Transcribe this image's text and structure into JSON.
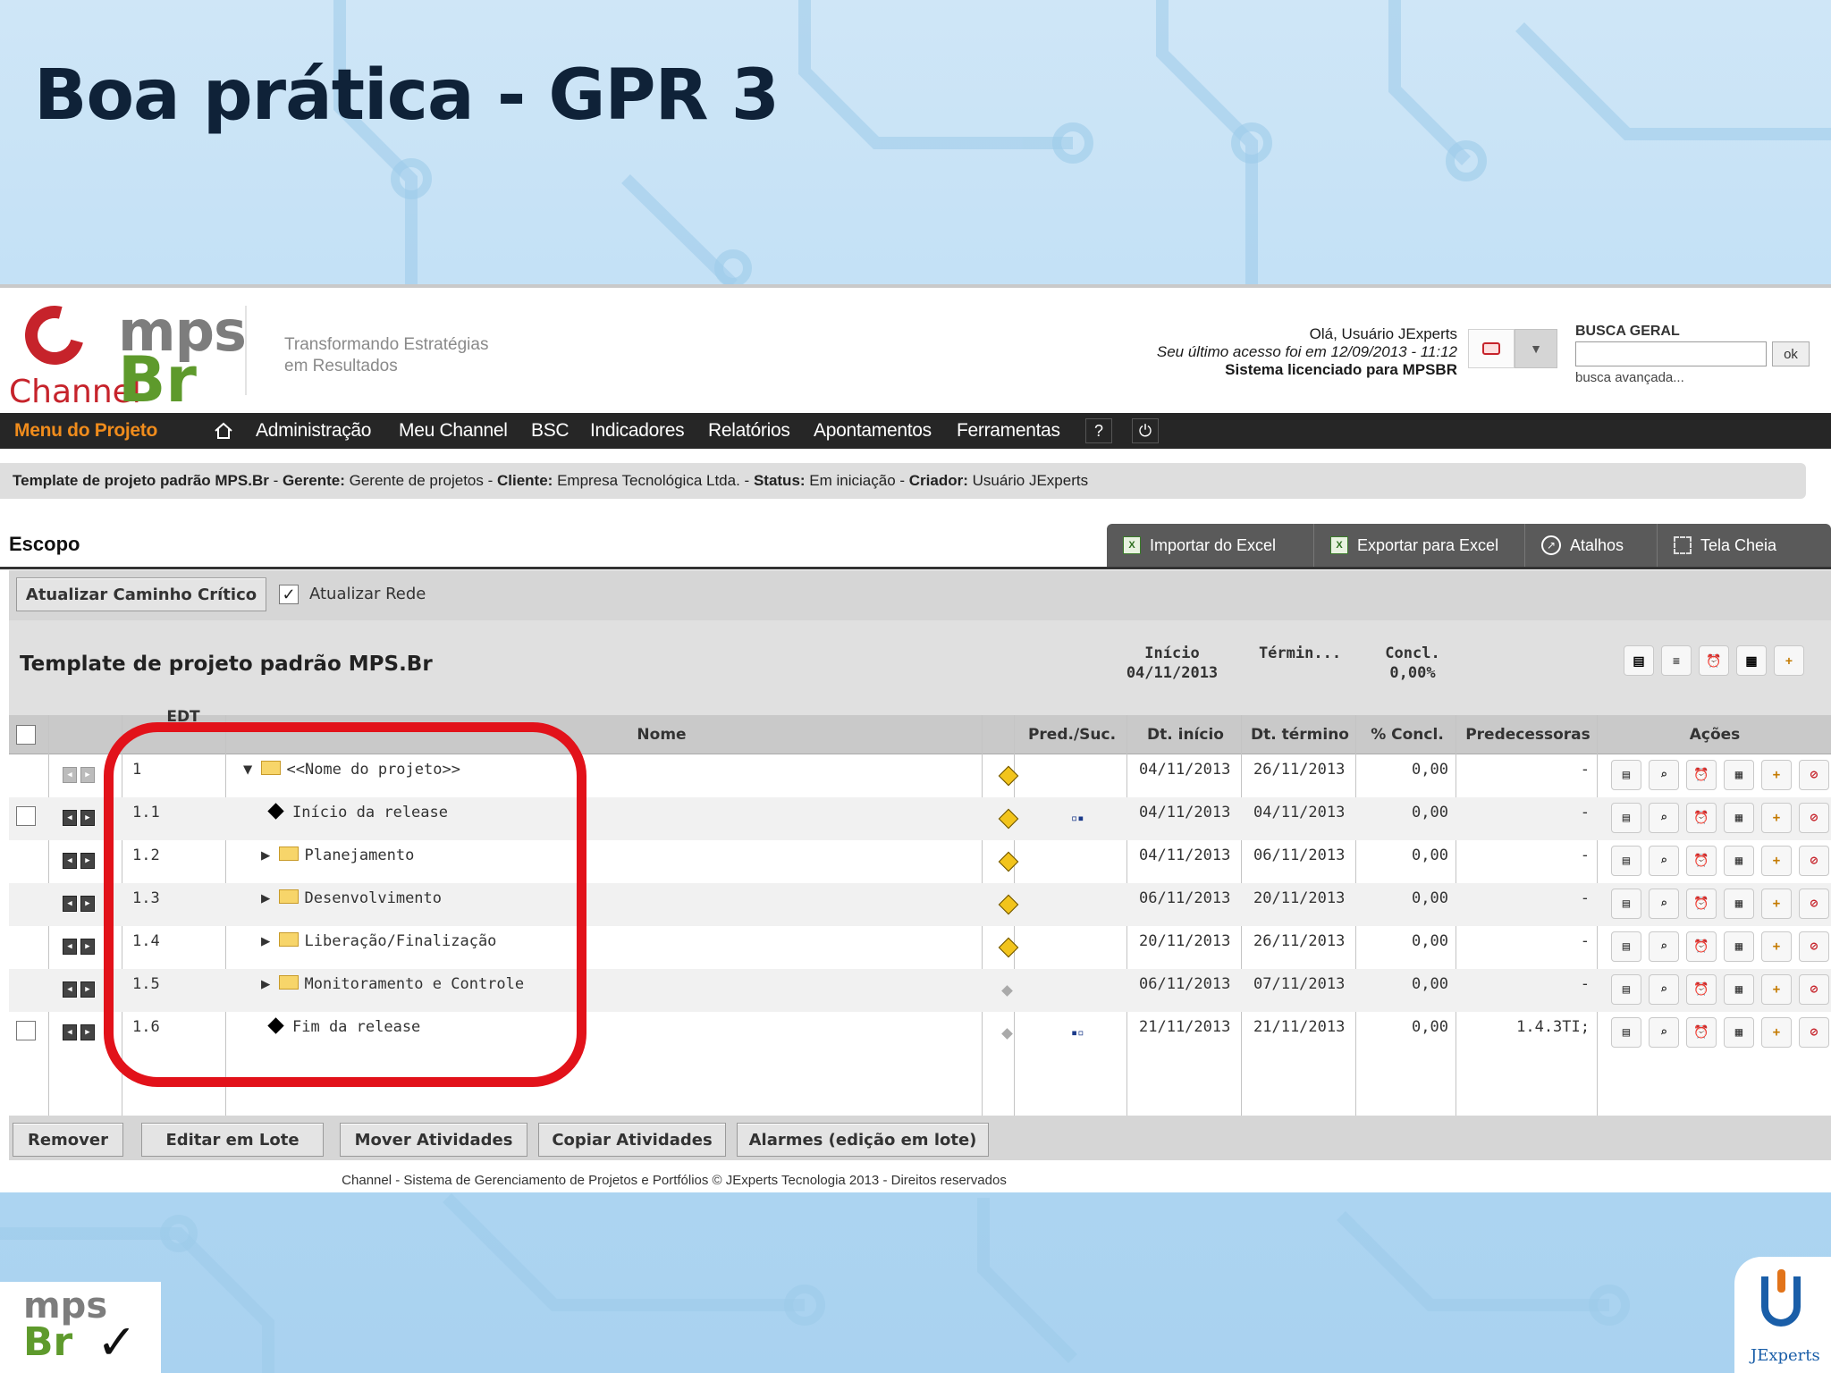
{
  "slide": {
    "title": "Boa prática - GPR 3"
  },
  "header": {
    "logo_channel": "Channel",
    "logo_mps": "mps",
    "logo_br": "Br",
    "tagline_1": "Transformando Estratégias",
    "tagline_2": "em Resultados",
    "greeting": "Olá, Usuário JExperts",
    "last_access": "Seu último acesso foi em 12/09/2013 - 11:12",
    "license": "Sistema licenciado para MPSBR",
    "search_label": "BUSCA GERAL",
    "search_value": "",
    "search_ok": "ok",
    "search_advanced": "busca avançada..."
  },
  "nav": {
    "menu": "Menu do Projeto",
    "items": [
      "Administração",
      "Meu Channel",
      "BSC",
      "Indicadores",
      "Relatórios",
      "Apontamentos",
      "Ferramentas"
    ],
    "help": "?",
    "power": "⏻"
  },
  "info": {
    "project": "Template de projeto padrão MPS.Br",
    "gerente_label": "Gerente:",
    "gerente": "Gerente de projetos",
    "cliente_label": "Cliente:",
    "cliente": "Empresa Tecnológica Ltda.",
    "status_label": "Status:",
    "status": "Em iniciação",
    "criador_label": "Criador:",
    "criador": "Usuário JExperts"
  },
  "scope": {
    "title": "Escopo",
    "toolbar": [
      "Importar do Excel",
      "Exportar para Excel",
      "Atalhos",
      "Tela Cheia"
    ],
    "update_critical": "Atualizar Caminho Crítico",
    "update_network": "Atualizar Rede",
    "update_network_checked": true
  },
  "project_band": {
    "title": "Template de projeto padrão MPS.Br",
    "inicio_label": "Início",
    "inicio": "04/11/2013",
    "termino_label": "Términ...",
    "concl_label": "Concl.",
    "concl": "0,00%"
  },
  "grid": {
    "headers": {
      "edt": "EDT",
      "nome": "Nome",
      "pred_suc": "Pred./Suc.",
      "dt_inicio": "Dt. início",
      "dt_termino": "Dt. término",
      "concl": "% Concl.",
      "predecessoras": "Predecessoras",
      "acoes": "Ações"
    },
    "rows": [
      {
        "edt": "1",
        "nome": "<<Nome do projeto>>",
        "kind": "folder-open",
        "status": "warn",
        "pred": "",
        "inicio": "04/11/2013",
        "termino": "26/11/2013",
        "concl": "0,00",
        "predecessoras": "-",
        "checkbox": false
      },
      {
        "edt": "1.1",
        "nome": "Início da release",
        "kind": "milestone",
        "status": "warn",
        "pred": "▫▪",
        "inicio": "04/11/2013",
        "termino": "04/11/2013",
        "concl": "0,00",
        "predecessoras": "-",
        "checkbox": true
      },
      {
        "edt": "1.2",
        "nome": "Planejamento",
        "kind": "folder",
        "status": "warn",
        "pred": "",
        "inicio": "04/11/2013",
        "termino": "06/11/2013",
        "concl": "0,00",
        "predecessoras": "-",
        "checkbox": false
      },
      {
        "edt": "1.3",
        "nome": "Desenvolvimento",
        "kind": "folder",
        "status": "warn",
        "pred": "",
        "inicio": "06/11/2013",
        "termino": "20/11/2013",
        "concl": "0,00",
        "predecessoras": "-",
        "checkbox": false
      },
      {
        "edt": "1.4",
        "nome": "Liberação/Finalização",
        "kind": "folder",
        "status": "warn",
        "pred": "",
        "inicio": "20/11/2013",
        "termino": "26/11/2013",
        "concl": "0,00",
        "predecessoras": "-",
        "checkbox": false
      },
      {
        "edt": "1.5",
        "nome": "Monitoramento e Controle",
        "kind": "folder",
        "status": "dot",
        "pred": "",
        "inicio": "06/11/2013",
        "termino": "07/11/2013",
        "concl": "0,00",
        "predecessoras": "-",
        "checkbox": false
      },
      {
        "edt": "1.6",
        "nome": "Fim da release",
        "kind": "milestone",
        "status": "dot",
        "pred": "▪▫",
        "inicio": "21/11/2013",
        "termino": "21/11/2013",
        "concl": "0,00",
        "predecessoras": "1.4.3TI;",
        "checkbox": true
      }
    ]
  },
  "bottom_buttons": [
    "Remover",
    "Editar em Lote",
    "Mover Atividades",
    "Copiar Atividades",
    "Alarmes (edição em lote)"
  ],
  "footer": "Channel - Sistema de Gerenciamento de Projetos e Portfólios © JExperts Tecnologia 2013 - Direitos reservados",
  "corner": {
    "left_mps": "mps",
    "left_br": "Br",
    "right_brand": "JExperts"
  },
  "colors": {
    "accent_orange": "#f08c1c",
    "navbar": "#262626",
    "highlight_red": "#e2121a",
    "brand_red": "#c6232b",
    "brand_green": "#5e9a2c"
  }
}
